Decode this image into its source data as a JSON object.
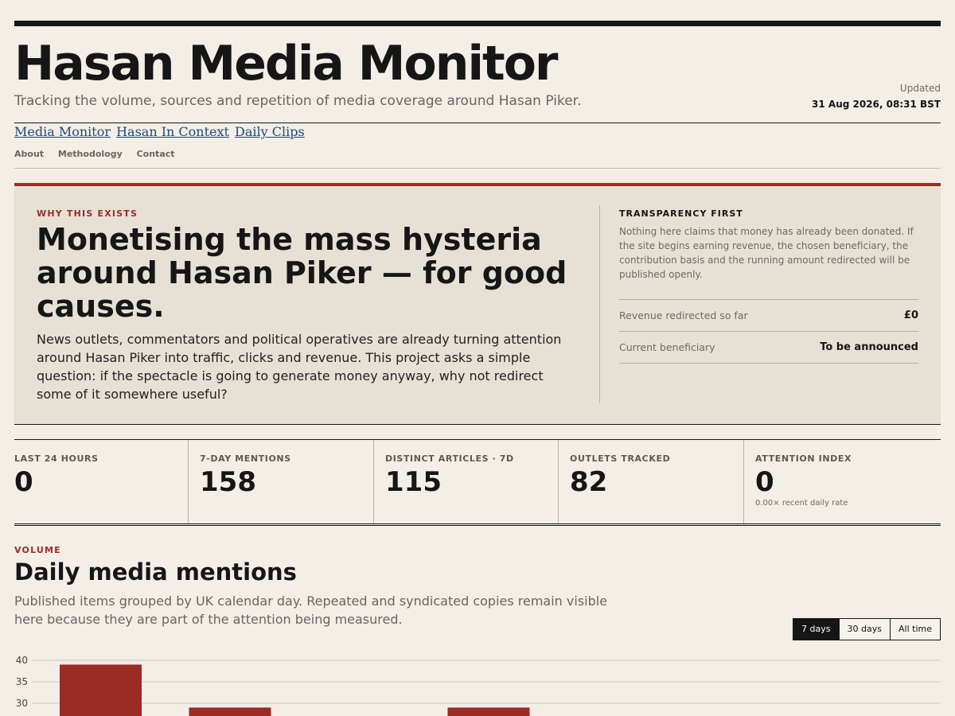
{
  "header": {
    "title": "Hasan Media Monitor",
    "subtitle": "Tracking the volume, sources and repetition of media coverage around Hasan Piker.",
    "updated_label": "Updated",
    "updated_value": "31 Aug 2026, 08:31 BST"
  },
  "nav": {
    "links": [
      "Media Monitor",
      "Hasan In Context",
      "Daily Clips"
    ],
    "sub": [
      "About",
      "Methodology",
      "Contact"
    ]
  },
  "hero": {
    "kicker": "WHY THIS EXISTS",
    "headline": "Monetising the mass hysteria around Hasan Piker — for good causes.",
    "body": "News outlets, commentators and political operatives are already turning attention around Hasan Piker into traffic, clicks and revenue. This project asks a simple question: if the spectacle is going to generate money anyway, why not redirect some of it somewhere useful?",
    "side_kicker": "TRANSPARENCY FIRST",
    "side_text": "Nothing here claims that money has already been donated. If the site begins earning revenue, the chosen beneficiary, the contribution basis and the running amount redirected will be published openly.",
    "rows": [
      {
        "label": "Revenue redirected so far",
        "value": "£0"
      },
      {
        "label": "Current beneficiary",
        "value": "To be announced"
      }
    ]
  },
  "stats": [
    {
      "label": "LAST 24 HOURS",
      "value": "0",
      "note": ""
    },
    {
      "label": "7-DAY MENTIONS",
      "value": "158",
      "note": ""
    },
    {
      "label": "DISTINCT ARTICLES · 7D",
      "value": "115",
      "note": ""
    },
    {
      "label": "OUTLETS TRACKED",
      "value": "82",
      "note": ""
    },
    {
      "label": "ATTENTION INDEX",
      "value": "0",
      "note": "0.00× recent daily rate"
    }
  ],
  "volume": {
    "kicker": "VOLUME",
    "title": "Daily media mentions",
    "description": "Published items grouped by UK calendar day. Repeated and syndicated copies remain visible here because they are part of the attention being measured.",
    "ranges": [
      "7 days",
      "30 days",
      "All time"
    ],
    "active_range": "7 days"
  },
  "chart_data": {
    "type": "bar",
    "y_ticks": [
      30,
      35,
      40
    ],
    "values": [
      39,
      29,
      null,
      29
    ],
    "color": "#9a2c24"
  },
  "colors": {
    "accent": "#9a2c24",
    "link": "#1d4b7a",
    "background": "#f3eee6",
    "panel": "#e7e0d5"
  }
}
